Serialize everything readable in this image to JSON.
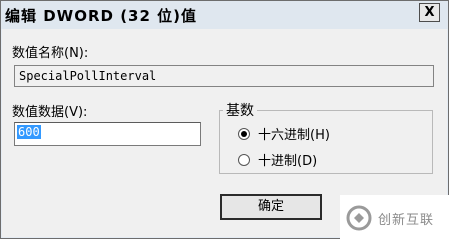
{
  "window": {
    "title": "编辑 DWORD (32 位)值",
    "close_icon": "close-icon",
    "close_glyph": "X"
  },
  "value_name": {
    "label": "数值名称(N):",
    "value": "SpecialPollInterval"
  },
  "value_data": {
    "label": "数值数据(V):",
    "value": "600"
  },
  "base": {
    "title": "基数",
    "options": [
      {
        "label": "十六进制(H)",
        "selected": true
      },
      {
        "label": "十进制(D)",
        "selected": false
      }
    ]
  },
  "buttons": {
    "ok_label": "确定"
  },
  "watermark": {
    "text": "创新互联",
    "logo_icon": "brand-logo-icon"
  },
  "colors": {
    "selection": "#3399ff",
    "dialog_bg": "#f0f0f0",
    "title_bg": "#dfe7ef"
  }
}
